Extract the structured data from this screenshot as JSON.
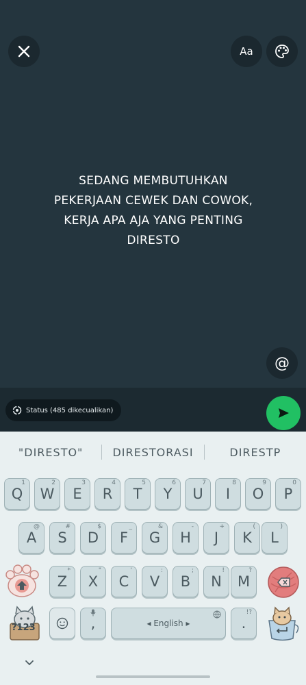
{
  "editor": {
    "status_lines": [
      "SEDANG MEMBUTUHKAN",
      "PEKERJAAN CEWEK DAN COWOK,",
      "KERJA APA AJA YANG PENTING",
      "DIRESTO"
    ],
    "font_button_label": "Aa",
    "mention_label": "@"
  },
  "bottom_bar": {
    "audience_label": "Status (485 dikecualikan)"
  },
  "keyboard": {
    "suggestions": [
      "\"DIRESTO\"",
      "DIRESTORASI",
      "DIRESTP"
    ],
    "row1": [
      {
        "label": "Q",
        "hint": "1"
      },
      {
        "label": "W",
        "hint": "2"
      },
      {
        "label": "E",
        "hint": "3"
      },
      {
        "label": "R",
        "hint": "4"
      },
      {
        "label": "T",
        "hint": "5"
      },
      {
        "label": "Y",
        "hint": "6"
      },
      {
        "label": "U",
        "hint": "7"
      },
      {
        "label": "I",
        "hint": "8"
      },
      {
        "label": "O",
        "hint": "9"
      },
      {
        "label": "P",
        "hint": "0"
      }
    ],
    "row2": [
      {
        "label": "A",
        "hint": "@"
      },
      {
        "label": "S",
        "hint": "#"
      },
      {
        "label": "D",
        "hint": "$"
      },
      {
        "label": "F",
        "hint": "_"
      },
      {
        "label": "G",
        "hint": "&"
      },
      {
        "label": "H",
        "hint": "-"
      },
      {
        "label": "J",
        "hint": "+"
      },
      {
        "label": "K",
        "hint": "("
      },
      {
        "label": "L",
        "hint": ")"
      }
    ],
    "row3": [
      {
        "label": "Z",
        "hint": "*"
      },
      {
        "label": "X",
        "hint": "\""
      },
      {
        "label": "C",
        "hint": "'"
      },
      {
        "label": "V",
        "hint": ":"
      },
      {
        "label": "B",
        "hint": ";"
      },
      {
        "label": "N",
        "hint": "!"
      },
      {
        "label": "M",
        "hint": "?"
      }
    ],
    "symbols_label": "?123",
    "comma_label": ",",
    "space_label": "◂ English ▸",
    "period_label": ".",
    "period_hint": "!?",
    "accent_color": "#21c063"
  }
}
